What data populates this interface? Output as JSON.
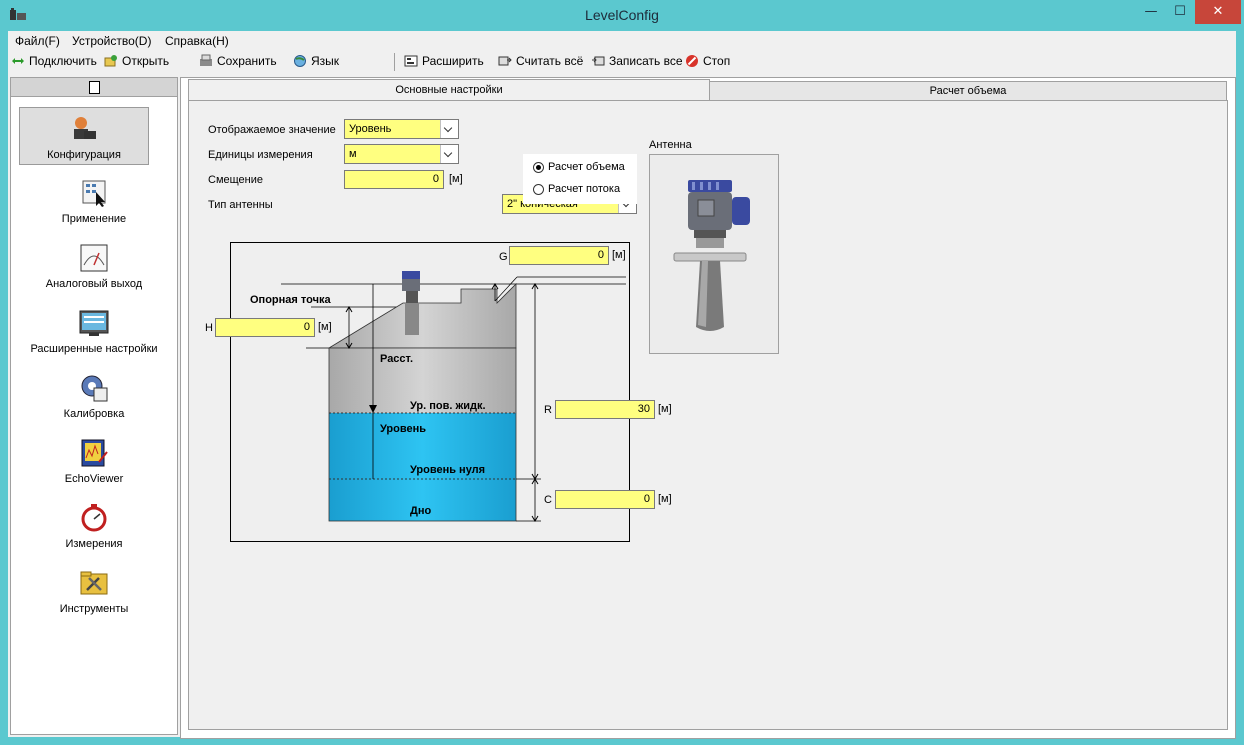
{
  "window": {
    "title": "LevelConfig",
    "minimize": "—",
    "maximize": "☐",
    "close": "✕"
  },
  "menu": [
    {
      "label": "Файл(F)"
    },
    {
      "label": "Устройство(D)"
    },
    {
      "label": "Справка(H)"
    }
  ],
  "toolbar": {
    "connect": "Подключить",
    "open": "Открыть",
    "save": "Сохранить",
    "language": "Язык",
    "expand": "Расширить",
    "read_all": "Считать всё",
    "write_all": "Записать все",
    "stop": "Стоп"
  },
  "sidebar": {
    "items": [
      {
        "label": "Конфигурация",
        "icon": "configuration-icon"
      },
      {
        "label": "Применение",
        "icon": "application-icon"
      },
      {
        "label": "Аналоговый выход",
        "icon": "analog-output-icon"
      },
      {
        "label": "Расширенные настройки",
        "icon": "advanced-settings-icon"
      },
      {
        "label": "Калибровка",
        "icon": "calibration-icon"
      },
      {
        "label": "EchoViewer",
        "icon": "echoviewer-icon"
      },
      {
        "label": "Измерения",
        "icon": "measurement-icon"
      },
      {
        "label": "Инструменты",
        "icon": "tools-icon"
      }
    ]
  },
  "tabs": [
    {
      "label": "Основные настройки"
    },
    {
      "label": "Расчет объема"
    }
  ],
  "form": {
    "display_value_label": "Отображаемое значение",
    "display_value": "Уровень",
    "units_label": "Единицы измерения",
    "units_value": "м",
    "offset_label": "Смещение",
    "offset_value": "0",
    "offset_unit": "[м]",
    "antenna_type_label": "Тип антенны",
    "antenna_type_value": "2\" коническая",
    "radio_volume": "Расчет объема",
    "radio_flow": "Расчет потока",
    "antenna_label": "Антенна"
  },
  "diagram": {
    "G_label": "G",
    "G_value": "0",
    "G_unit": "[м]",
    "H_label": "H",
    "H_value": "0",
    "H_unit": "[м]",
    "R_label": "R",
    "R_value": "30",
    "R_unit": "[м]",
    "C_label": "C",
    "C_value": "0",
    "C_unit": "[м]",
    "ref_point": "Опорная точка",
    "distance": "Расст.",
    "liquid_level": "Ур. пов. жидк.",
    "level": "Уровень",
    "zero_level": "Уровень нуля",
    "bottom": "Дно"
  },
  "colors": {
    "field_bg": "#ffff80",
    "liquid": "#1fb4e8",
    "titlebar": "#5bc8cf"
  }
}
